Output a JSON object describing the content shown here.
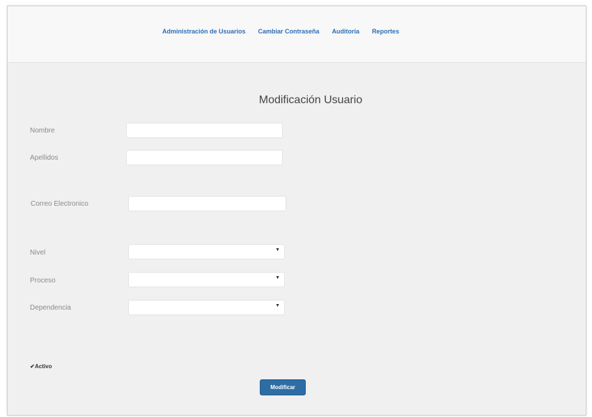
{
  "nav": {
    "items": [
      {
        "label": "Administración de Usuarios"
      },
      {
        "label": "Cambiar Contraseña"
      },
      {
        "label": "Auditoria"
      },
      {
        "label": "Reportes"
      }
    ]
  },
  "form": {
    "title": "Modificación Usuario",
    "fields": {
      "nombre": {
        "label": "Nombre",
        "value": ""
      },
      "apellidos": {
        "label": "Apellidos",
        "value": ""
      },
      "correo": {
        "label": "Correo Electronico",
        "value": ""
      },
      "nivel": {
        "label": "Nivel",
        "value": ""
      },
      "proceso": {
        "label": "Proceso",
        "value": ""
      },
      "dependencia": {
        "label": "Dependencia",
        "value": ""
      }
    },
    "activo": {
      "label": "Activo",
      "checked": true,
      "mark": "✔"
    },
    "submit_label": "Modificar"
  },
  "colors": {
    "link": "#2c6fb5",
    "button": "#2e6da4",
    "background": "#f0f0f0"
  },
  "icons": {
    "select_caret": "caret-down-icon"
  }
}
